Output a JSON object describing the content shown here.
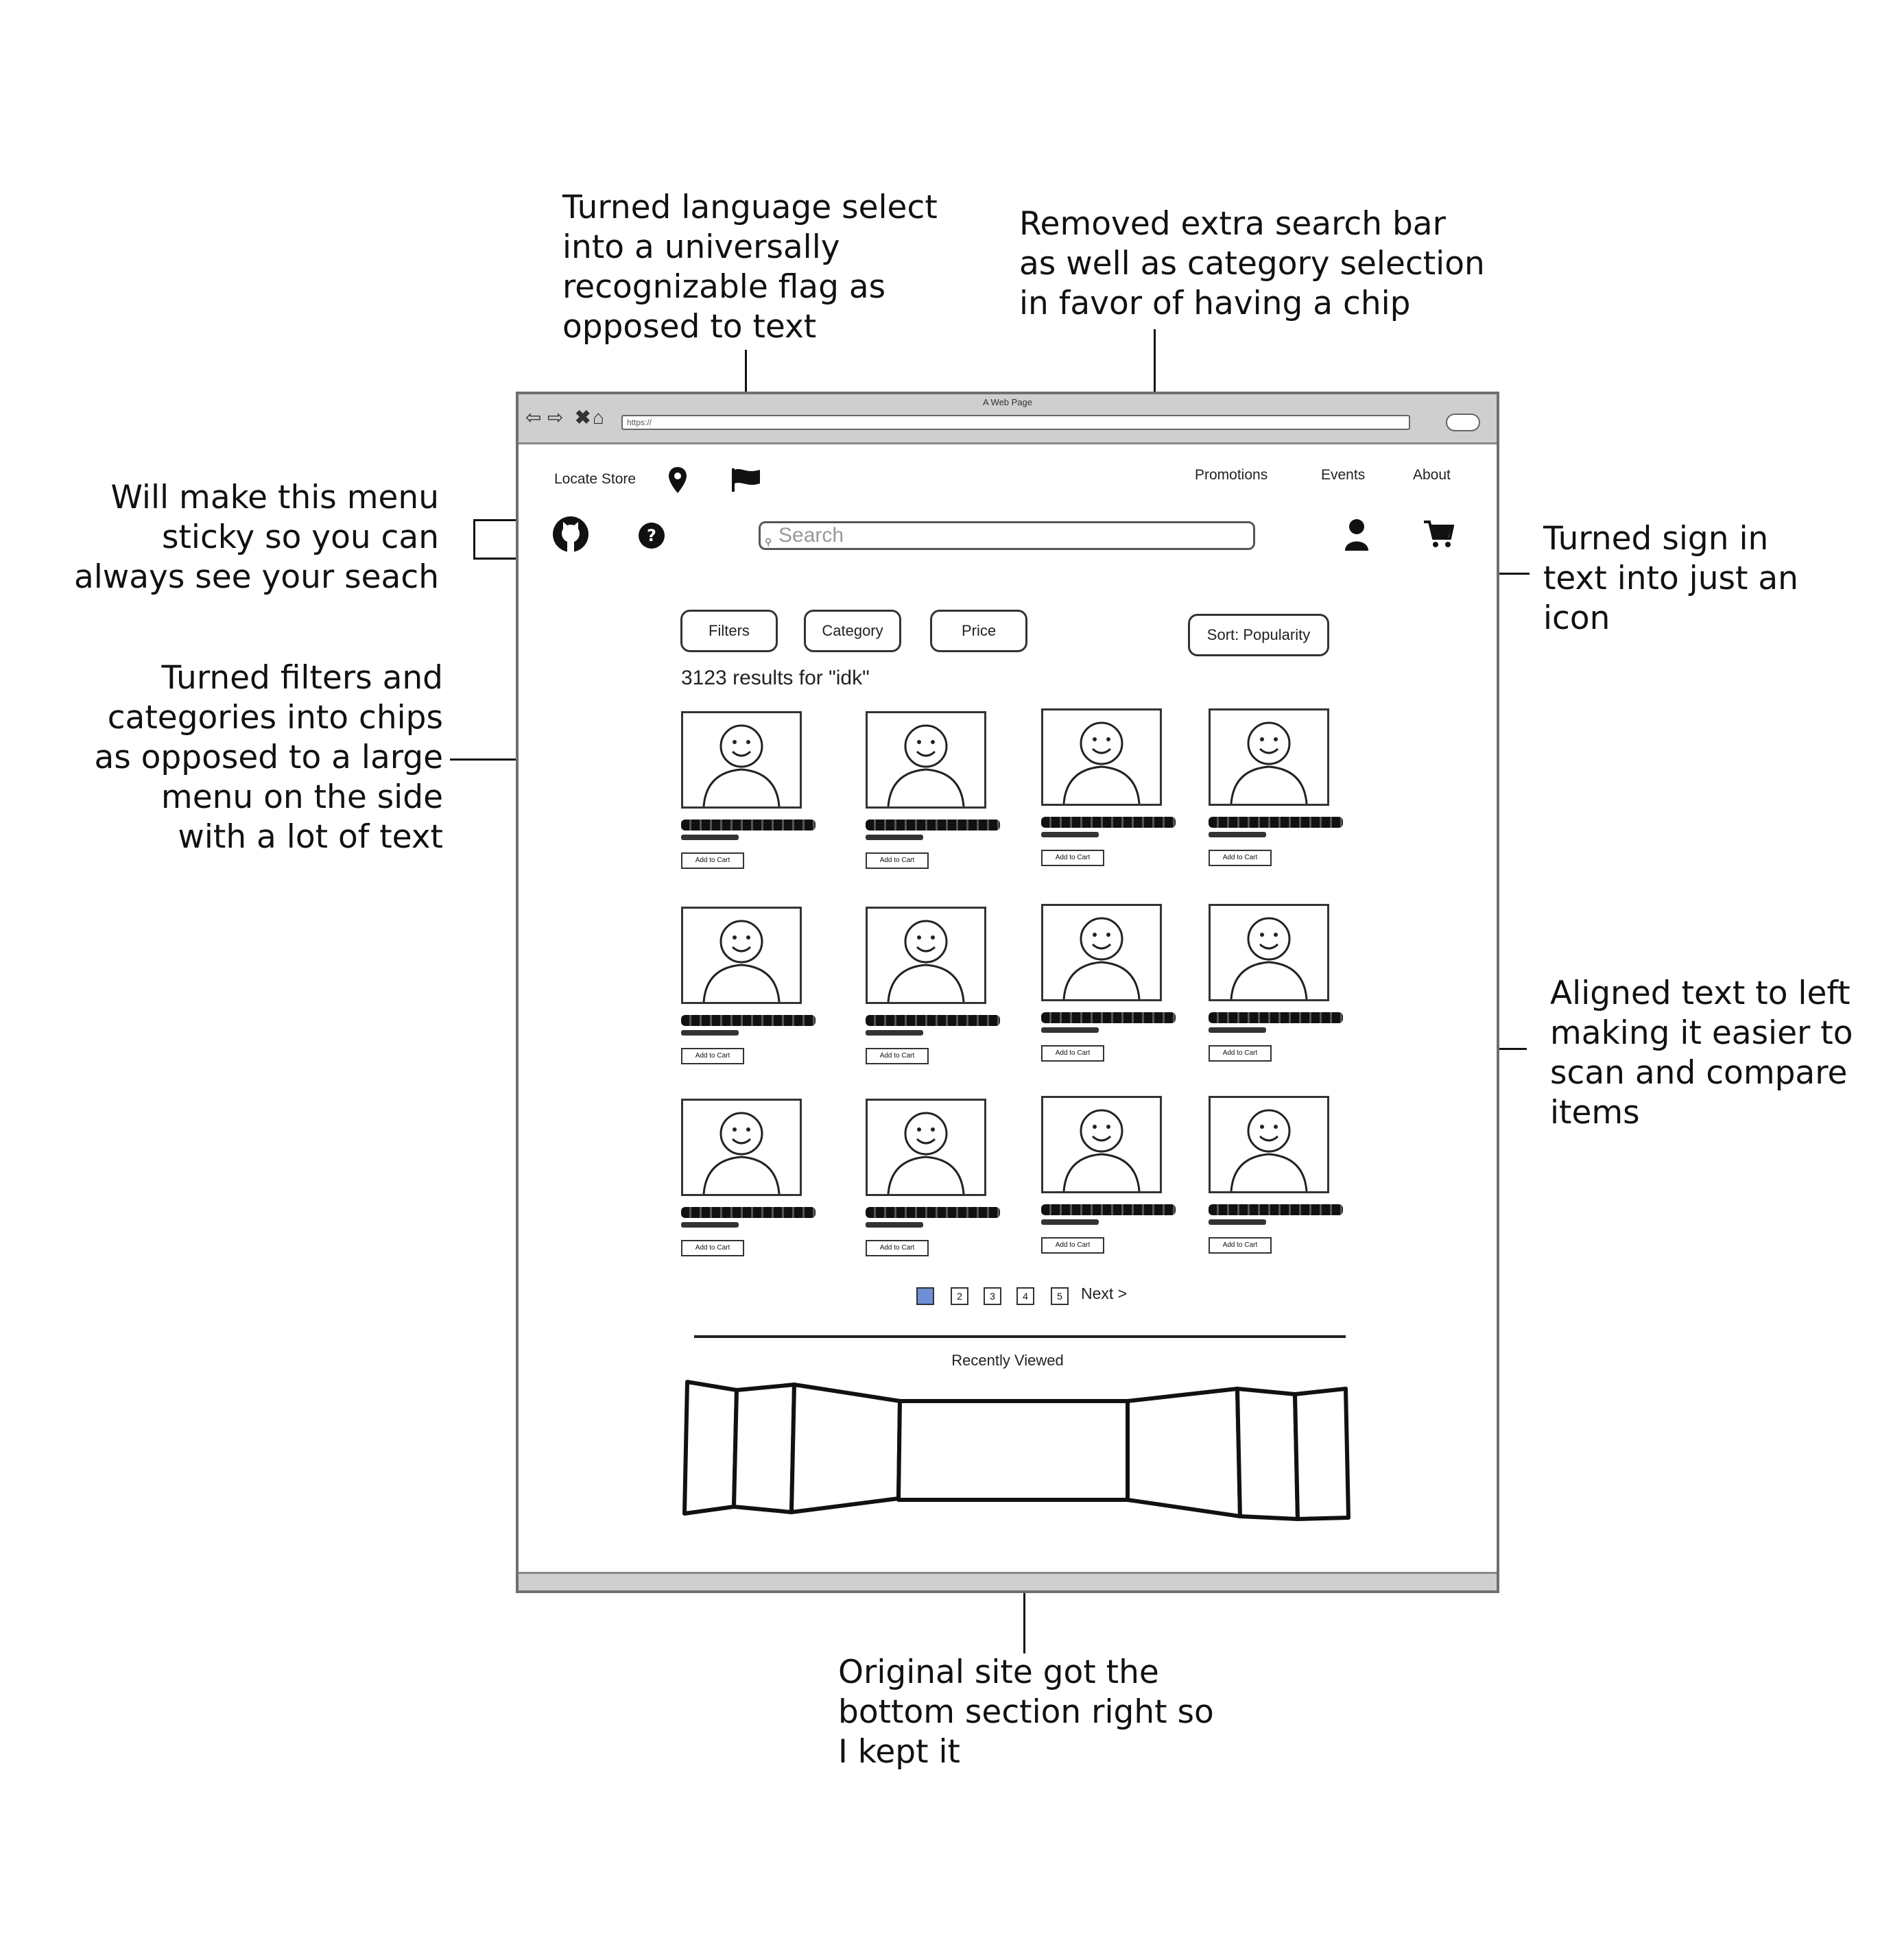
{
  "annotations": {
    "language": "Turned language select\ninto a universally\nrecognizable flag as\nopposed to text",
    "search": "Removed extra search bar\nas well as category selection\nin favor of having a chip",
    "sticky": "Will make this menu\nsticky so you can\nalways see your seach",
    "signin": "Turned sign in\ntext into just an\nicon",
    "filters": "Turned filters and\ncategories into chips\nas opposed to a large\nmenu on the side\nwith a lot of text",
    "aligned": "Aligned text to left\nmaking it easier to\nscan and compare\nitems",
    "bottom": "Original site got the\nbottom section right so\nI kept it"
  },
  "browser": {
    "title": "A Web Page",
    "url": "https://"
  },
  "header": {
    "locate_store": "Locate Store",
    "nav": [
      "Promotions",
      "Events",
      "About"
    ],
    "search_placeholder": "Search"
  },
  "icons": {
    "location": "map-pin-icon",
    "language": "flag-icon",
    "logo": "github-icon",
    "help": "question-circle-icon",
    "account": "user-icon",
    "cart": "shopping-cart-icon"
  },
  "chips": [
    "Filters",
    "Category",
    "Price"
  ],
  "sort_label": "Sort: Popularity",
  "results_text": "3123 results for \"idk\"",
  "products": {
    "add_label": "Add to Cart",
    "count": 12
  },
  "pagination": {
    "pages": [
      "1",
      "2",
      "3",
      "4",
      "5"
    ],
    "active": 0,
    "next": "Next >",
    "active_color": "#6e8fd6"
  },
  "recently_viewed": "Recently Viewed"
}
